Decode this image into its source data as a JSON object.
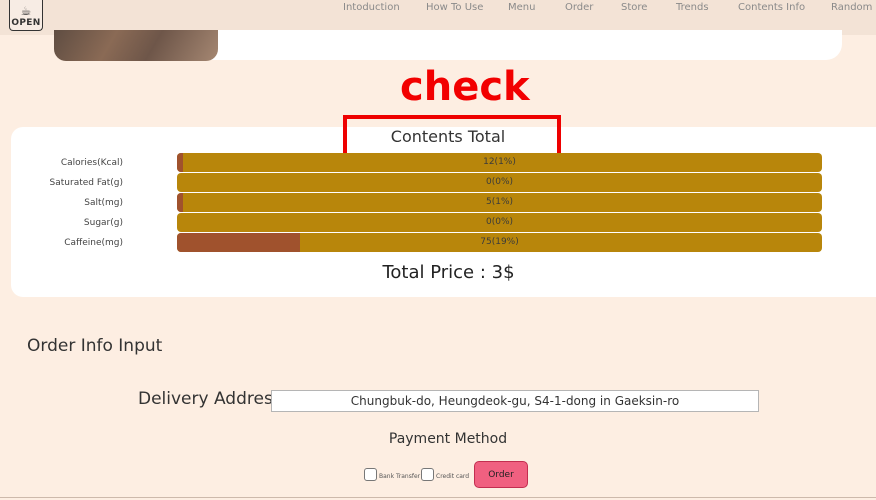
{
  "header": {
    "logo_text": "OPEN",
    "logo_icon": "coffee-cup-icon",
    "nav": [
      "Intoduction",
      "How To Use",
      "Menu",
      "Order",
      "Store",
      "Trends",
      "Contents Info",
      "Random"
    ]
  },
  "annotation": {
    "check_label": "check",
    "highlight_color": "#ee0000"
  },
  "contents": {
    "title": "Contents Total",
    "nutrients": [
      {
        "label": "Calories(Kcal)",
        "value_text": "12(1%)",
        "percent": 1
      },
      {
        "label": "Saturated Fat(g)",
        "value_text": "0(0%)",
        "percent": 0
      },
      {
        "label": "Salt(mg)",
        "value_text": "5(1%)",
        "percent": 1
      },
      {
        "label": "Sugar(g)",
        "value_text": "0(0%)",
        "percent": 0
      },
      {
        "label": "Caffeine(mg)",
        "value_text": "75(19%)",
        "percent": 19
      }
    ],
    "bar_colors": {
      "track": "#b8860b",
      "fill": "#a0522d"
    },
    "total_price": "Total Price : 3$"
  },
  "order": {
    "section_title": "Order Info Input",
    "address_label": "Delivery Address :",
    "address_value": "Chungbuk-do, Heungdeok-gu, S4-1-dong in Gaeksin-ro",
    "payment_title": "Payment Method",
    "payment_options": [
      "Bank Transfer",
      "Credit card"
    ],
    "order_button": "Order",
    "order_button_color": "#f06080"
  }
}
